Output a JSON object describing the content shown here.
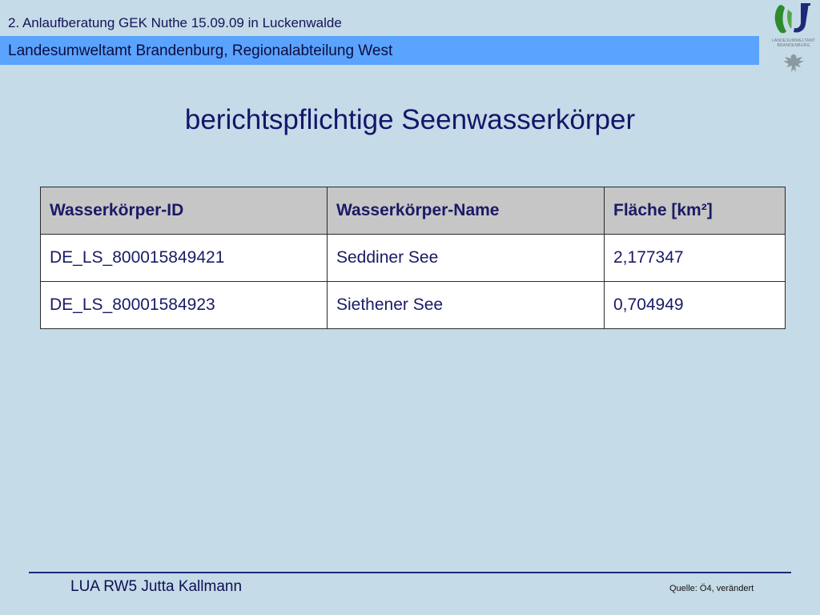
{
  "header": {
    "event_line": "2. Anlaufberatung GEK Nuthe 15.09.09 in Luckenwalde",
    "organization": "Landesumweltamt Brandenburg, Regionalabteilung West"
  },
  "logo": {
    "caption_line1": "LANDESUMWELTAMT",
    "caption_line2": "BRANDENBURG",
    "colors": [
      "#2e8b2e",
      "#1c2a78"
    ]
  },
  "slide": {
    "title": "berichtspflichtige Seenwasserkörper"
  },
  "table": {
    "headers": [
      "Wasserkörper-ID",
      "Wasserkörper-Name",
      "Fläche [km²]"
    ],
    "rows": [
      [
        "DE_LS_800015849421",
        "Seddiner See",
        "2,177347"
      ],
      [
        "DE_LS_80001584923",
        "Siethener See",
        "0,704949"
      ]
    ]
  },
  "footer": {
    "author": "LUA RW5 Jutta Kallmann",
    "source": "Quelle: Ö4, verändert"
  },
  "colors": {
    "background": "#c5dbe7",
    "header_bar": "#5aa3ff",
    "title_text": "#15156a",
    "table_header": "#c6c6c6"
  }
}
